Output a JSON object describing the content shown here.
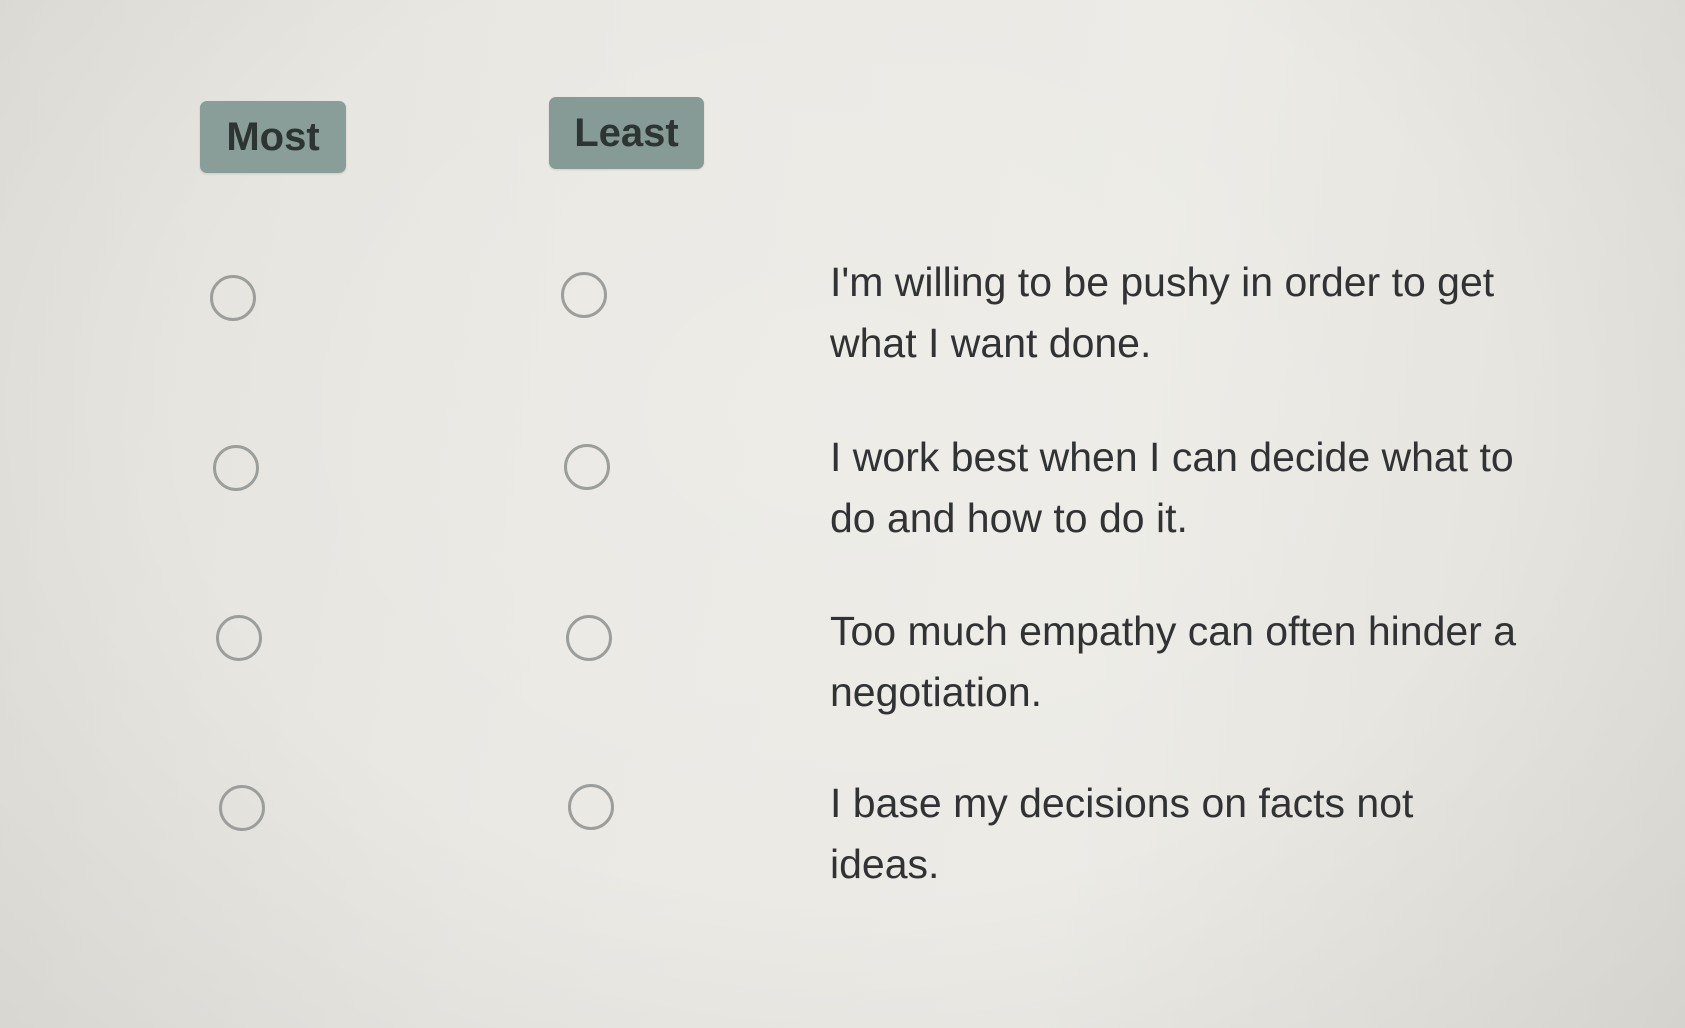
{
  "headers": {
    "most": "Most",
    "least": "Least"
  },
  "statements": [
    "I'm willing to be pushy in order to get what I want done.",
    "I work best when I can decide what to do and how to do it.",
    "Too much empathy can often hinder a negotiation.",
    "I base my decisions on facts not ideas."
  ],
  "colors": {
    "badge_background": "#8a9e99",
    "badge_text": "#2d3532",
    "radio_border": "#9c9e9b",
    "statement_text": "#303234"
  }
}
